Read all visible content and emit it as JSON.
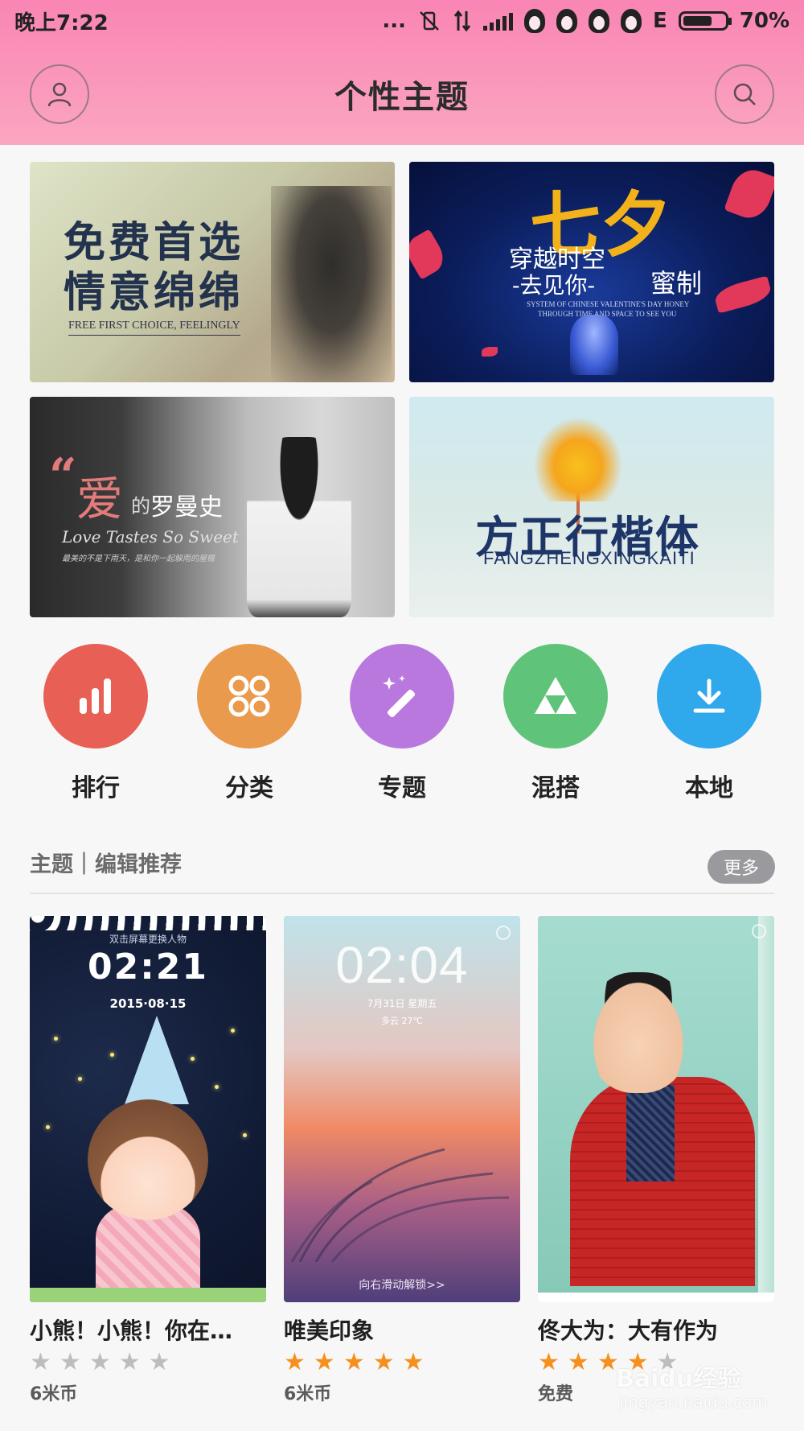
{
  "status_bar": {
    "time": "晚上7:22",
    "dots": "...",
    "network": "E",
    "battery_percent": "70%",
    "battery_level": 0.7
  },
  "header": {
    "title": "个性主题",
    "left_icon": "user-icon",
    "right_icon": "search-icon",
    "gradient_colors": [
      "#f985b4",
      "#fba6c0"
    ]
  },
  "banners": [
    {
      "line1": "免费首选",
      "line2": "情意绵绵",
      "subtitle": "FREE FIRST CHOICE, FEELINGLY"
    },
    {
      "big": "七夕",
      "line1": "穿越时空",
      "line2": "-去见你-",
      "line3": "蜜制",
      "sub1": "SYSTEM OF CHINESE VALENTINE'S DAY HONEY",
      "sub2": "THROUGH TIME AND SPACE TO SEE YOU"
    },
    {
      "quote": "“",
      "ai": "爱",
      "de": "的",
      "romance": "罗曼史",
      "english": "Love Tastes So Sweet",
      "small": "最美的不是下雨天，是和你一起躲雨的屋檐"
    },
    {
      "cn": "方正行楷体",
      "en": "FANGZHENGXINGKAITI"
    }
  ],
  "categories": [
    {
      "label": "排行",
      "icon": "bar-chart-icon",
      "color": "#e75f55"
    },
    {
      "label": "分类",
      "icon": "grid-icon",
      "color": "#e99a4c"
    },
    {
      "label": "专题",
      "icon": "magic-wand-icon",
      "color": "#b978dd"
    },
    {
      "label": "混搭",
      "icon": "triangle-icon",
      "color": "#5fc479"
    },
    {
      "label": "本地",
      "icon": "download-icon",
      "color": "#2fa8ec"
    }
  ],
  "section": {
    "title": "主题｜编辑推荐",
    "more_label": "更多"
  },
  "themes": [
    {
      "name": "小熊！小熊！你在…",
      "rating": 0,
      "price": "6米币",
      "preview": {
        "hint": "双击屏幕更换人物",
        "clock": "02:21",
        "date": "2015·08·15"
      }
    },
    {
      "name": "唯美印象",
      "rating": 5,
      "price": "6米币",
      "preview": {
        "clock": "02:04",
        "date": "7月31日 星期五",
        "weather": "多云 27℃",
        "unlock": "向右滑动解锁>>"
      }
    },
    {
      "name": "佟大为：大有作为",
      "rating": 4,
      "price": "免费",
      "preview": {}
    }
  ],
  "colors": {
    "star_on": "#f5901e",
    "star_off": "#bdbdbd",
    "more_button": "#9a9a9e"
  },
  "watermark": {
    "brand": "Baidu经验",
    "url": "jingyan.baidu.com"
  }
}
